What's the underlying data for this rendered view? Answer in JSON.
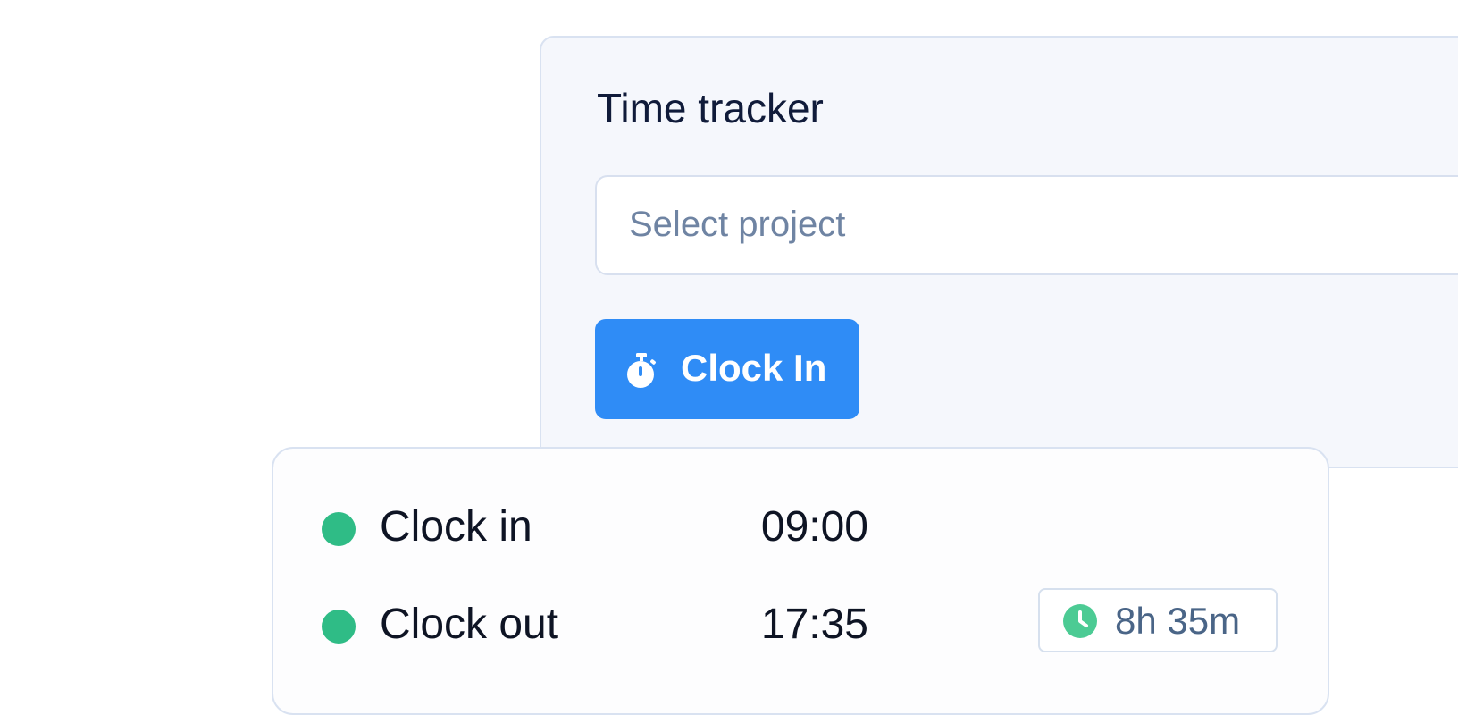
{
  "tracker": {
    "title": "Time tracker",
    "project_select": {
      "placeholder": "Select project",
      "value": ""
    },
    "clock_in_button": {
      "label": "Clock In",
      "icon": "stopwatch-icon"
    }
  },
  "log": {
    "entries": [
      {
        "label": "Clock in",
        "time": "09:00",
        "status_icon": "status-dot"
      },
      {
        "label": "Clock out",
        "time": "17:35",
        "status_icon": "status-dot"
      }
    ],
    "duration": {
      "value": "8h 35m",
      "icon": "clock-icon"
    }
  },
  "colors": {
    "accent": "#2f8cf6",
    "status_green": "#2fbc86",
    "badge_icon_green": "#4ccb94",
    "title_text": "#101b3a",
    "placeholder_text": "#6f84a3",
    "badge_text": "#4a6587",
    "card_background": "#f5f7fc",
    "border": "#d9e2f1"
  }
}
